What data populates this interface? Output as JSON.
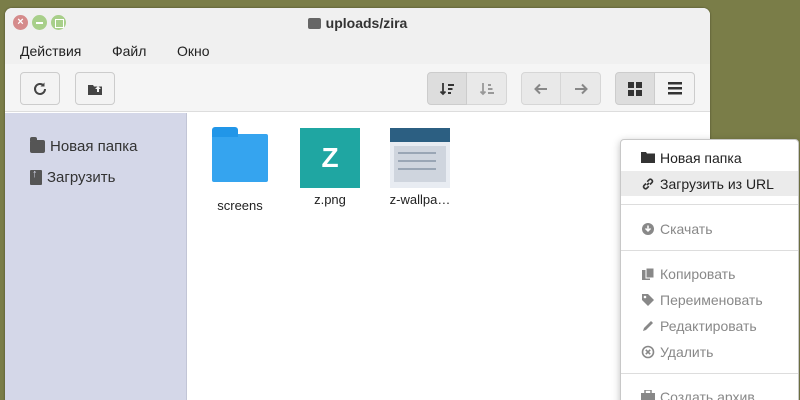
{
  "window": {
    "title": "uploads/zira"
  },
  "menubar": {
    "items": [
      "Действия",
      "Файл",
      "Окно"
    ]
  },
  "toolbar": {
    "refresh_icon": "refresh-icon",
    "new_folder_icon": "folder-upload-icon",
    "sort_desc_icon": "sort-desc-icon",
    "sort_asc_icon": "sort-asc-icon",
    "back_icon": "arrow-left-icon",
    "forward_icon": "arrow-right-icon",
    "grid_view_icon": "grid-icon",
    "list_view_icon": "list-icon"
  },
  "sidebar": {
    "items": [
      {
        "label": "Новая папка",
        "icon": "folder-icon"
      },
      {
        "label": "Загрузить",
        "icon": "upload-icon"
      }
    ]
  },
  "files": [
    {
      "name": "screens",
      "type": "folder"
    },
    {
      "name": "z.png",
      "type": "image",
      "letter": "Z"
    },
    {
      "name": "z-wallpa…",
      "type": "image"
    }
  ],
  "context_menu": {
    "items": [
      {
        "label": "Новая папка",
        "icon": "folder-icon",
        "state": "normal"
      },
      {
        "label": "Загрузить из URL",
        "icon": "link-icon",
        "state": "hover"
      },
      {
        "label": "Скачать",
        "icon": "download-icon",
        "state": "disabled"
      },
      {
        "label": "Копировать",
        "icon": "copy-icon",
        "state": "disabled"
      },
      {
        "label": "Переименовать",
        "icon": "tag-icon",
        "state": "disabled"
      },
      {
        "label": "Редактировать",
        "icon": "pencil-icon",
        "state": "disabled"
      },
      {
        "label": "Удалить",
        "icon": "delete-icon",
        "state": "disabled"
      },
      {
        "label": "Создать архив",
        "icon": "archive-icon",
        "state": "disabled"
      }
    ]
  },
  "colors": {
    "desktop": "#7a7d48",
    "sidebar": "#d4d7e8",
    "folder": "#35a4ef",
    "png_thumb": "#1fa6a2"
  }
}
